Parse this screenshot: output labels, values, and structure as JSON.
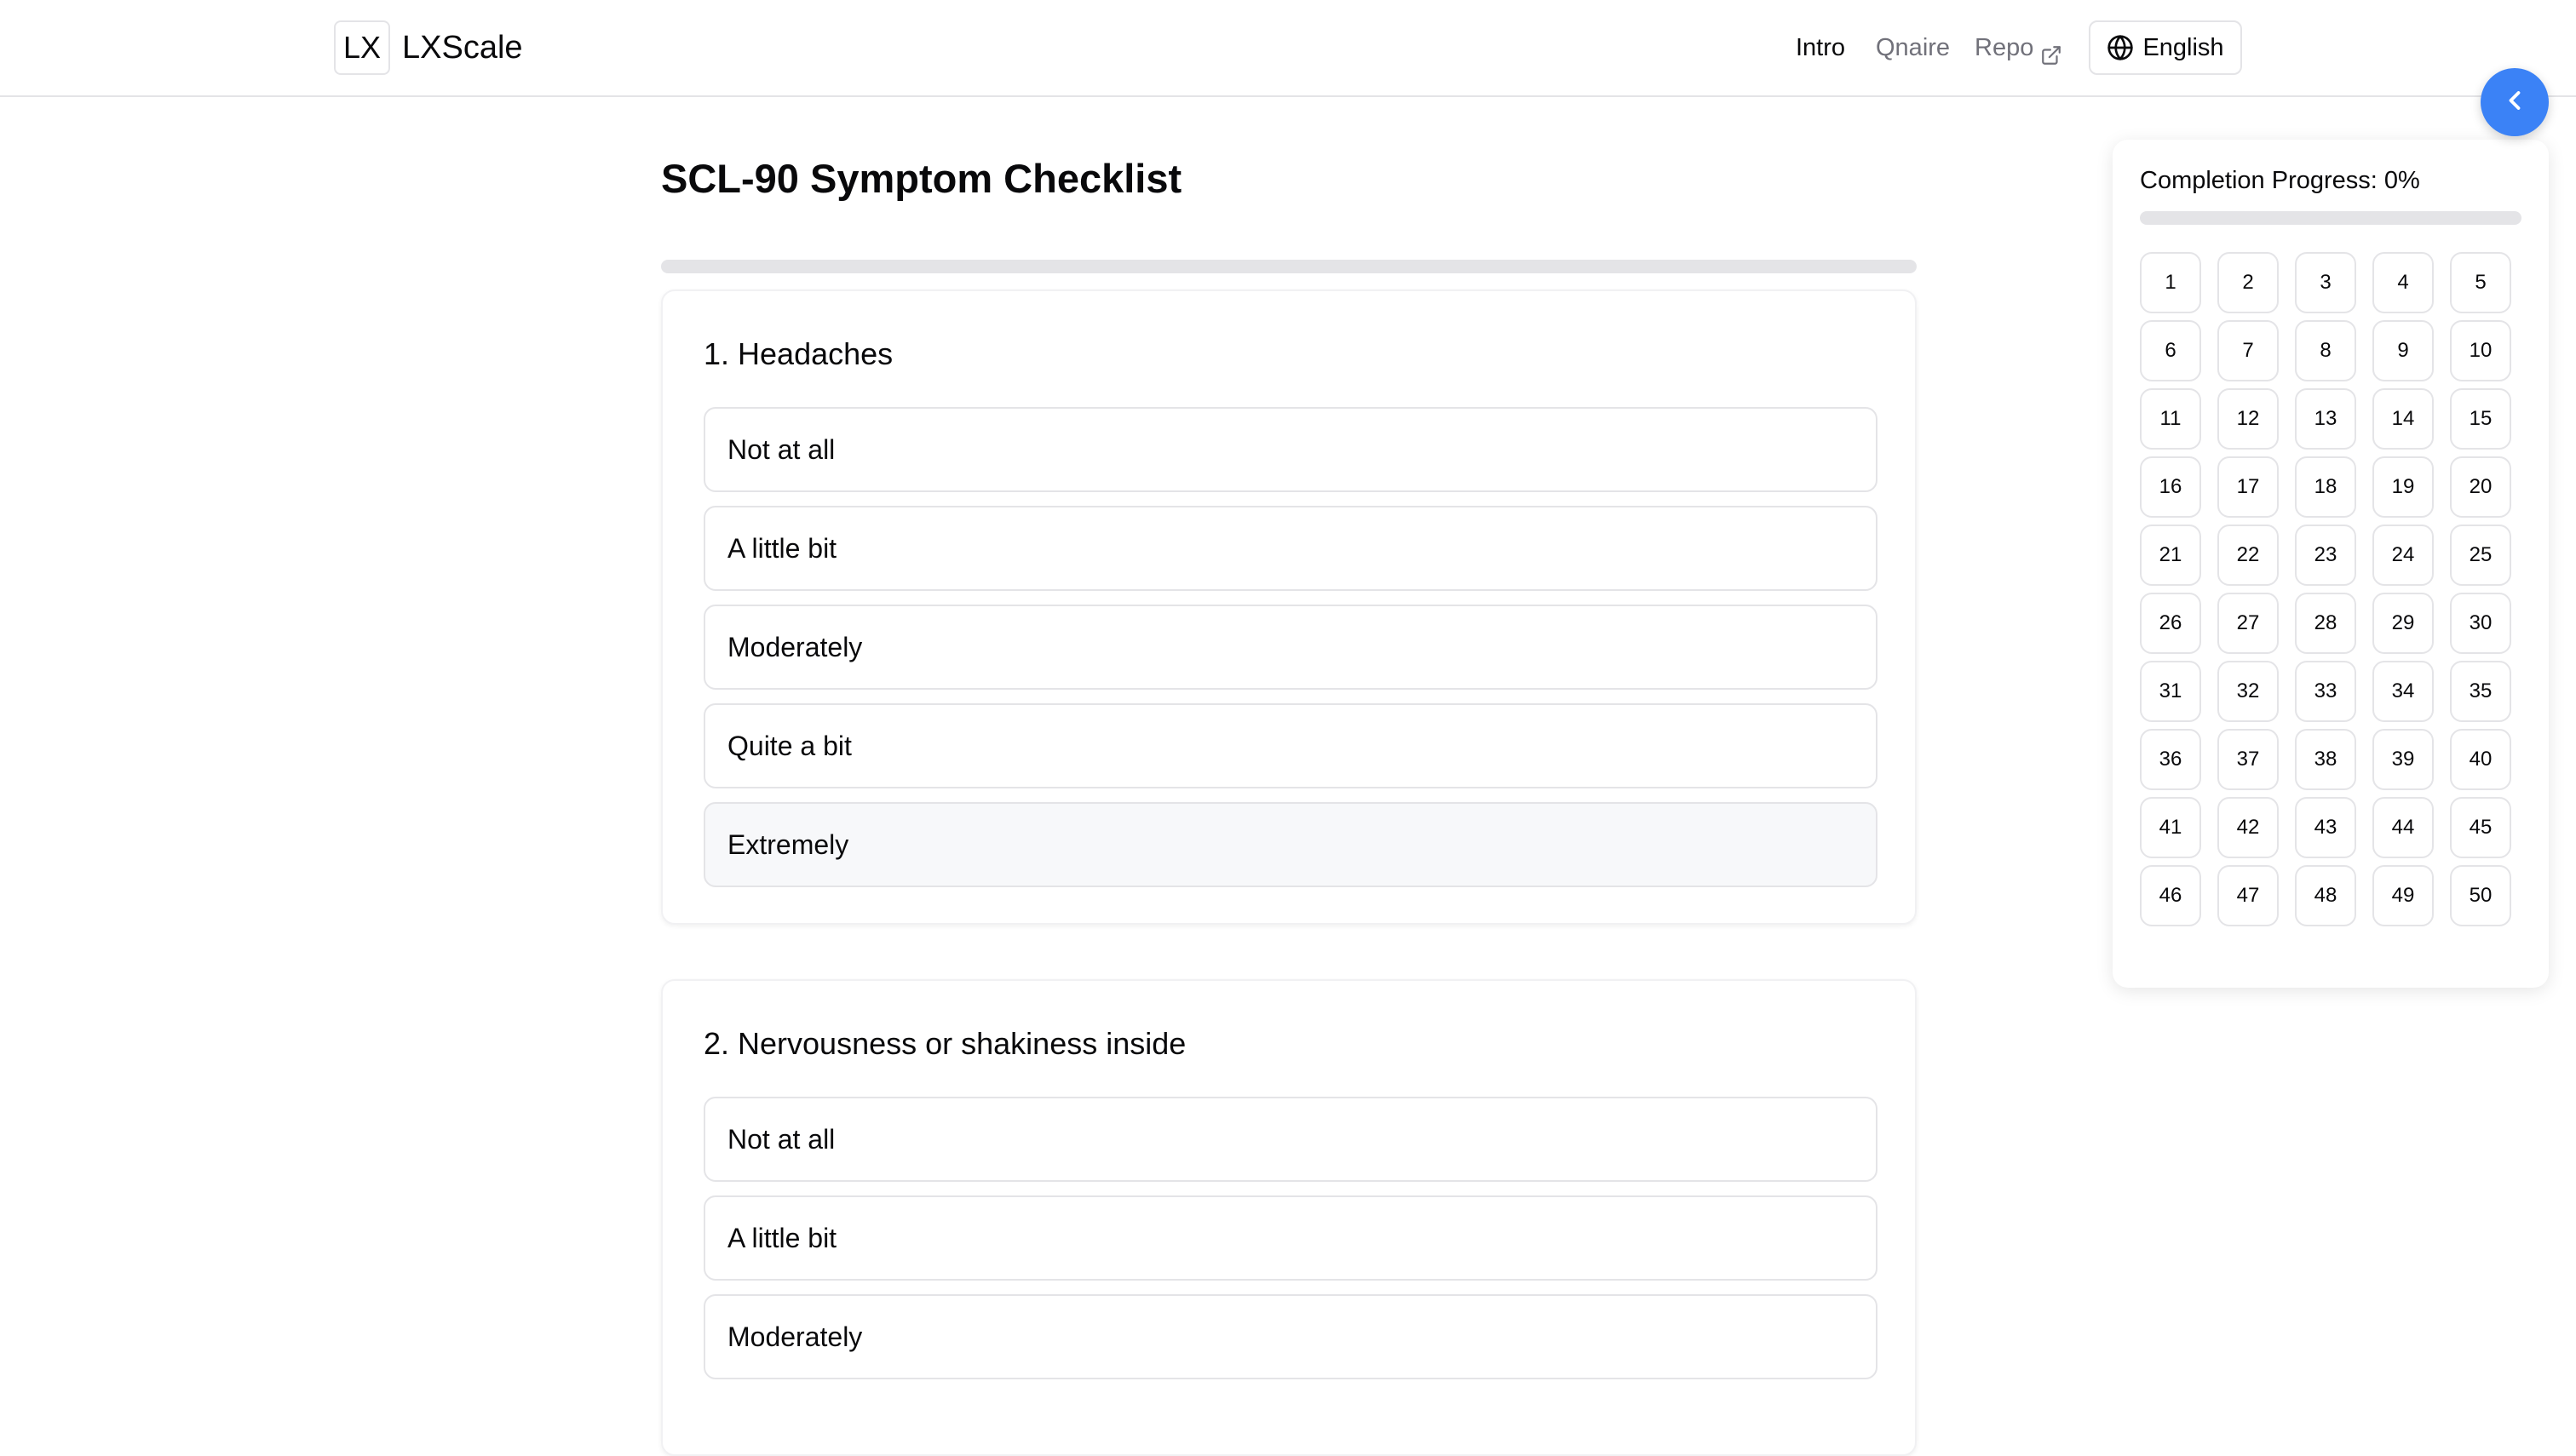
{
  "header": {
    "logo_mark": "LX",
    "brand": "LXScale",
    "nav": {
      "intro": "Intro",
      "qnaire": "Qnaire",
      "repo": "Repo"
    },
    "language": "English"
  },
  "main": {
    "title": "SCL-90 Symptom Checklist",
    "progress_fraction": 0,
    "questions": [
      {
        "title": "1. Headaches",
        "options": [
          "Not at all",
          "A little bit",
          "Moderately",
          "Quite a bit",
          "Extremely"
        ]
      },
      {
        "title": "2. Nervousness or shakiness inside",
        "options": [
          "Not at all",
          "A little bit",
          "Moderately"
        ]
      }
    ]
  },
  "panel": {
    "title": "Completion Progress: 0%",
    "progress_fraction": 0,
    "question_numbers": [
      "1",
      "2",
      "3",
      "4",
      "5",
      "6",
      "7",
      "8",
      "9",
      "10",
      "11",
      "12",
      "13",
      "14",
      "15",
      "16",
      "17",
      "18",
      "19",
      "20",
      "21",
      "22",
      "23",
      "24",
      "25",
      "26",
      "27",
      "28",
      "29",
      "30",
      "31",
      "32",
      "33",
      "34",
      "35",
      "36",
      "37",
      "38",
      "39",
      "40",
      "41",
      "42",
      "43",
      "44",
      "45",
      "46",
      "47",
      "48",
      "49",
      "50"
    ]
  },
  "colors": {
    "accent": "#3b82f6",
    "border": "#e4e4e7",
    "muted_text": "#71717a"
  },
  "icons": {
    "repo": "external-link-icon",
    "language": "globe-icon",
    "collapse": "chevron-left-icon"
  }
}
